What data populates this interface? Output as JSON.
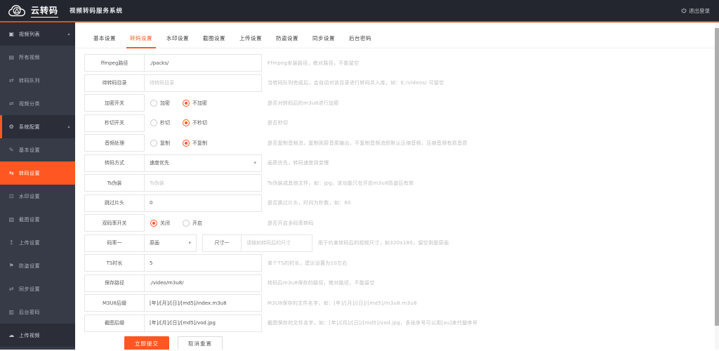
{
  "colors": {
    "accent": "#ff5722",
    "topbar_bg": "#23262e",
    "sidebar_bg": "#373b47",
    "sidebar_group_bg": "#2b2e38",
    "border": "#e6e6e6",
    "hint": "#bcbcbc"
  },
  "icons": {
    "video": "▣",
    "all_videos": "▤",
    "queue": "⇄",
    "category": "⇌",
    "gear": "⚙",
    "edit": "✎",
    "transcode": "⇆",
    "watermark": "⊡",
    "screenshot": "▧",
    "upload": "↥",
    "flag": "⚑",
    "sync": "⇄",
    "password": "▥",
    "cloud": "☁",
    "arrow_up": "▴",
    "caret": "▾"
  },
  "topbar": {
    "logo_text": "云转码",
    "app_title": "视频转码服务系统",
    "logout_label": "退出登录"
  },
  "sidebar": {
    "items": [
      {
        "label": "视频列表"
      },
      {
        "label": "所有视频"
      },
      {
        "label": "转码队列"
      },
      {
        "label": "视频分类"
      },
      {
        "label": "系统配置"
      },
      {
        "label": "基本设置"
      },
      {
        "label": "转码设置"
      },
      {
        "label": "水印设置"
      },
      {
        "label": "截图设置"
      },
      {
        "label": "上传设置"
      },
      {
        "label": "防盗设置"
      },
      {
        "label": "同步设置"
      },
      {
        "label": "后台密码"
      },
      {
        "label": "上传视频"
      }
    ]
  },
  "tabs": {
    "active": 1,
    "items": [
      "基本设置",
      "转码设置",
      "水印设置",
      "截图设置",
      "上传设置",
      "防盗设置",
      "同步设置",
      "后台密码"
    ]
  },
  "form": {
    "rows": [
      {
        "label": "ffmpeg路径",
        "value": "./packs/",
        "hint": "Ffmpeg安装路径，绝对路径，不能留空"
      },
      {
        "label": "待转码目录",
        "placeholder": "待转码目录",
        "hint": "当转码队列完成后，会自动对该目录进行转码并入库，如：E:/videos/ 可留空"
      },
      {
        "label": "加密开关",
        "options": [
          "加密",
          "不加密"
        ],
        "selected": 1,
        "hint": "是否对转码后的m3u8进行加密"
      },
      {
        "label": "秒切开关",
        "options": [
          "秒切",
          "不秒切"
        ],
        "selected": 1,
        "hint": "是否秒切"
      },
      {
        "label": "音频处理",
        "options": [
          "复制",
          "不复制"
        ],
        "selected": 1,
        "hint": "是否复制音频流，复制则原音质输出，不复制音频流即默认压缩音频，压缩音频有损音质"
      },
      {
        "label": "转码方式",
        "value": "速度优先",
        "hint": "画质优先，转码速度则变慢"
      },
      {
        "label": "Ts伪装",
        "placeholder": "Ts伪装",
        "hint": "Ts伪装成其他文件，如：jpg，该功能只在开启m3u8防盗后有效"
      },
      {
        "label": "跳过片头",
        "value": "0",
        "hint": "是否跳过片头，时间为秒数，如：60"
      },
      {
        "label": "双码率开关",
        "options": [
          "关闭",
          "开启"
        ],
        "selected": 0,
        "hint": "是否开启多码率转码"
      },
      {
        "label": "码率一",
        "value": "原画",
        "label2": "尺寸一",
        "placeholder2": "请输如转码后的尺寸",
        "hint": "用于约束转码后的视频尺寸，如320x180，留空则是原画"
      },
      {
        "label": "TS时长",
        "value": "5",
        "hint": "单个TS的时长，建议设置为10左右"
      },
      {
        "label": "保存路径",
        "value": "./video/m3u8/",
        "hint": "转码后m3u8保存的路径，绝对路径，不能留空"
      },
      {
        "label": "M3U8后缀",
        "value": "[年]/[月]/[日]/[md5]/index.m3u8",
        "hint": "M3U8保存的文件名字，如：[年]/[月]/[日]/[md5]/m3u8.m3u8"
      },
      {
        "label": "截图后缀",
        "value": "[年]/[月]/[日]/[md5]/vod.jpg",
        "hint": "截图保存的文件名字，如：[年]/[月]/[日]/[md5]/vod.jpg，多张序号可以用[xu]来代替序号"
      }
    ],
    "buttons": {
      "submit": "立即提交",
      "reset": "取消重置"
    }
  }
}
